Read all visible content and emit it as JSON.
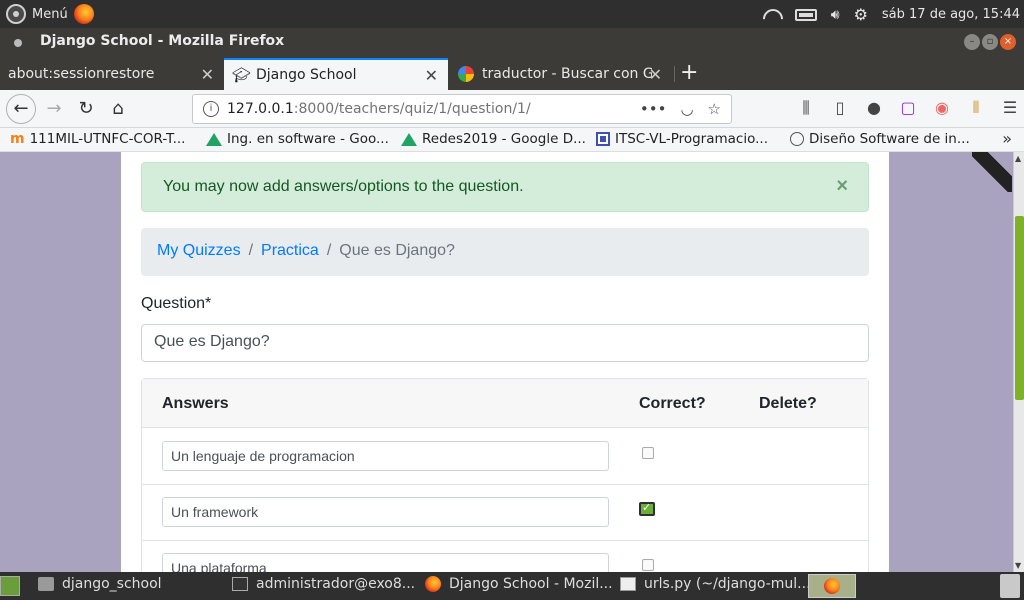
{
  "system": {
    "menu_label": "Menú",
    "datetime": "sáb 17 de ago, 15:44"
  },
  "window": {
    "title": "Django School - Mozilla Firefox"
  },
  "tabs": [
    {
      "label": "about:sessionrestore"
    },
    {
      "label": "Django School"
    },
    {
      "label": "traductor - Buscar con Go"
    }
  ],
  "navbar": {
    "url_host": "127.0.0.1",
    "url_path": ":8000/teachers/quiz/1/question/1/"
  },
  "bookmarks": [
    {
      "label": "111MIL-UTNFC-COR-T...",
      "icon": "moodle-icon"
    },
    {
      "label": "Ing. en software - Goo...",
      "icon": "drive-icon"
    },
    {
      "label": "Redes2019 - Google D...",
      "icon": "drive-icon"
    },
    {
      "label": "ITSC-VL-Programacio...",
      "icon": "square-icon"
    },
    {
      "label": "Diseño Software de in...",
      "icon": "globe-icon"
    }
  ],
  "page": {
    "alert": "You may now add answers/options to the question.",
    "alert_close": "×",
    "breadcrumb": [
      "My Quizzes",
      "Practica",
      "Que es Django?"
    ],
    "question_label": "Question*",
    "question_value": "Que es Django?",
    "answers_header": {
      "answers": "Answers",
      "correct": "Correct?",
      "delete": "Delete?"
    },
    "answers": [
      {
        "text": "Un lenguaje de programacion",
        "correct": false
      },
      {
        "text": "Un framework",
        "correct": true
      },
      {
        "text": "Una plataforma",
        "correct": false
      }
    ]
  },
  "taskbar": [
    {
      "label": "django_school",
      "icon": "folder-icon"
    },
    {
      "label": "administrador@exo8...",
      "icon": "terminal-icon"
    },
    {
      "label": "Django School - Mozil...",
      "icon": "firefox-icon"
    },
    {
      "label": "urls.py (~/django-mul...",
      "icon": "document-icon"
    }
  ],
  "colors": {
    "page_background": "#aaa3c0",
    "alert_bg": "#d4edda",
    "alert_text": "#155724",
    "link": "#007bff",
    "tab_accent": "#0a84ff",
    "scroll_thumb": "#7db12a"
  }
}
